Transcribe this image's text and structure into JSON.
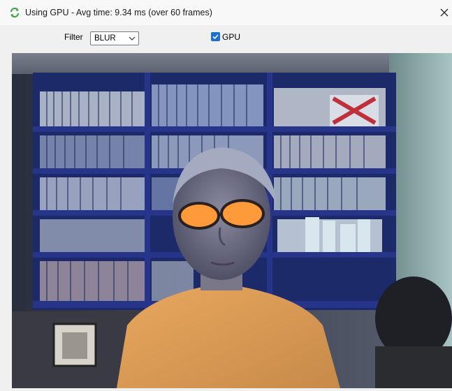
{
  "window": {
    "title": "Using GPU - Avg time: 9.34 ms (over 60 frames)",
    "icons": {
      "app": "refresh-arrows-icon",
      "close": "close-icon"
    }
  },
  "toolbar": {
    "filter_label": "Filter",
    "filter_value": "BLUR",
    "gpu_label": "GPU",
    "gpu_checked": true
  },
  "video": {
    "description_icon": "webcam-frame",
    "accent": "#1a6fd0"
  }
}
